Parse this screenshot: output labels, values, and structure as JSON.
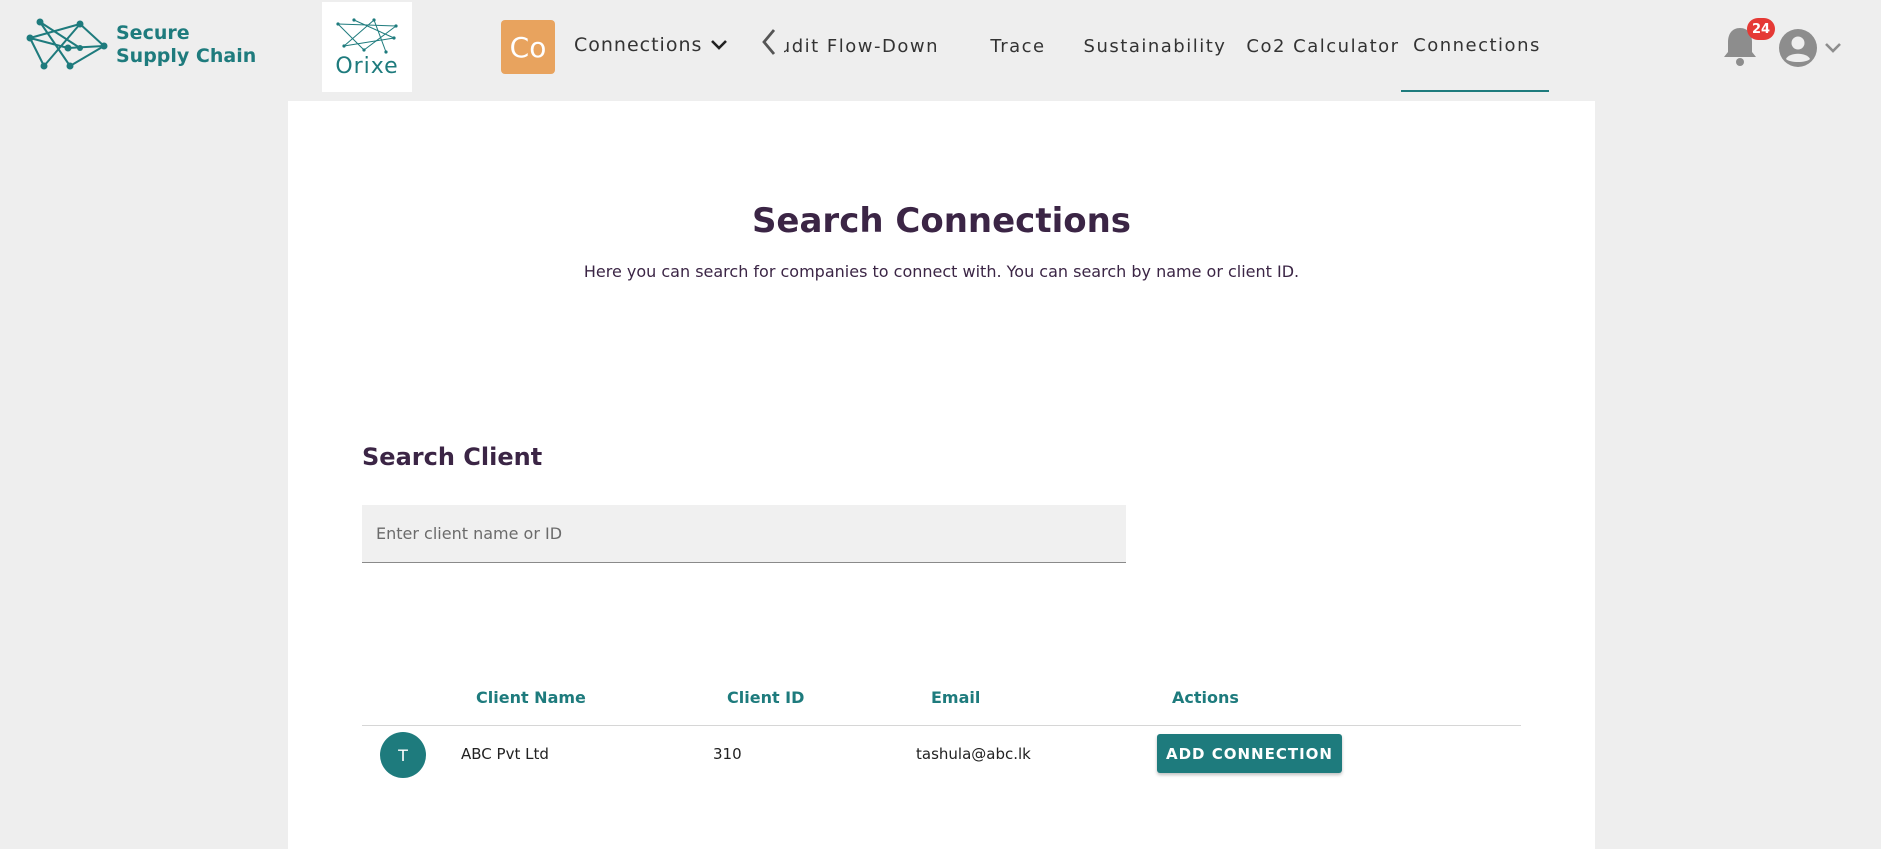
{
  "brand": {
    "line1": "Secure",
    "line2": "Supply Chain",
    "logo_icon": "network-nodes-icon"
  },
  "client_logo": {
    "text": "Orixe",
    "icon": "network-nodes-icon"
  },
  "org_avatar": {
    "initials": "Co",
    "color": "#e8a35e"
  },
  "module_selector": {
    "label": "Connections",
    "icon": "chevron-down-icon"
  },
  "nav": {
    "prev_icon": "chevron-left-icon",
    "tabs": [
      {
        "label": "Audit Flow-Down",
        "active": false
      },
      {
        "label": "Trace",
        "active": false
      },
      {
        "label": "Sustainability",
        "active": false
      },
      {
        "label": "Co2 Calculator",
        "active": false
      },
      {
        "label": "Connections",
        "active": true
      }
    ]
  },
  "notifications": {
    "icon": "bell-icon",
    "count": "24"
  },
  "user_menu": {
    "icon": "account-circle-icon",
    "chevron": "chevron-down-icon"
  },
  "page": {
    "title": "Search Connections",
    "description": "Here you can search for companies to connect with. You can search by name or client ID."
  },
  "search": {
    "heading": "Search Client",
    "placeholder": "Enter client name or ID",
    "value": ""
  },
  "table": {
    "headers": {
      "name": "Client Name",
      "id": "Client ID",
      "email": "Email",
      "actions": "Actions"
    },
    "rows": [
      {
        "avatar": "T",
        "name": "ABC Pvt Ltd",
        "id": "310",
        "email": "tashula@abc.lk",
        "action": "ADD CONNECTION"
      }
    ]
  },
  "colors": {
    "accent": "#1e7b7d",
    "title": "#3b2545",
    "badge": "#e53935",
    "background": "#eeeeee"
  }
}
